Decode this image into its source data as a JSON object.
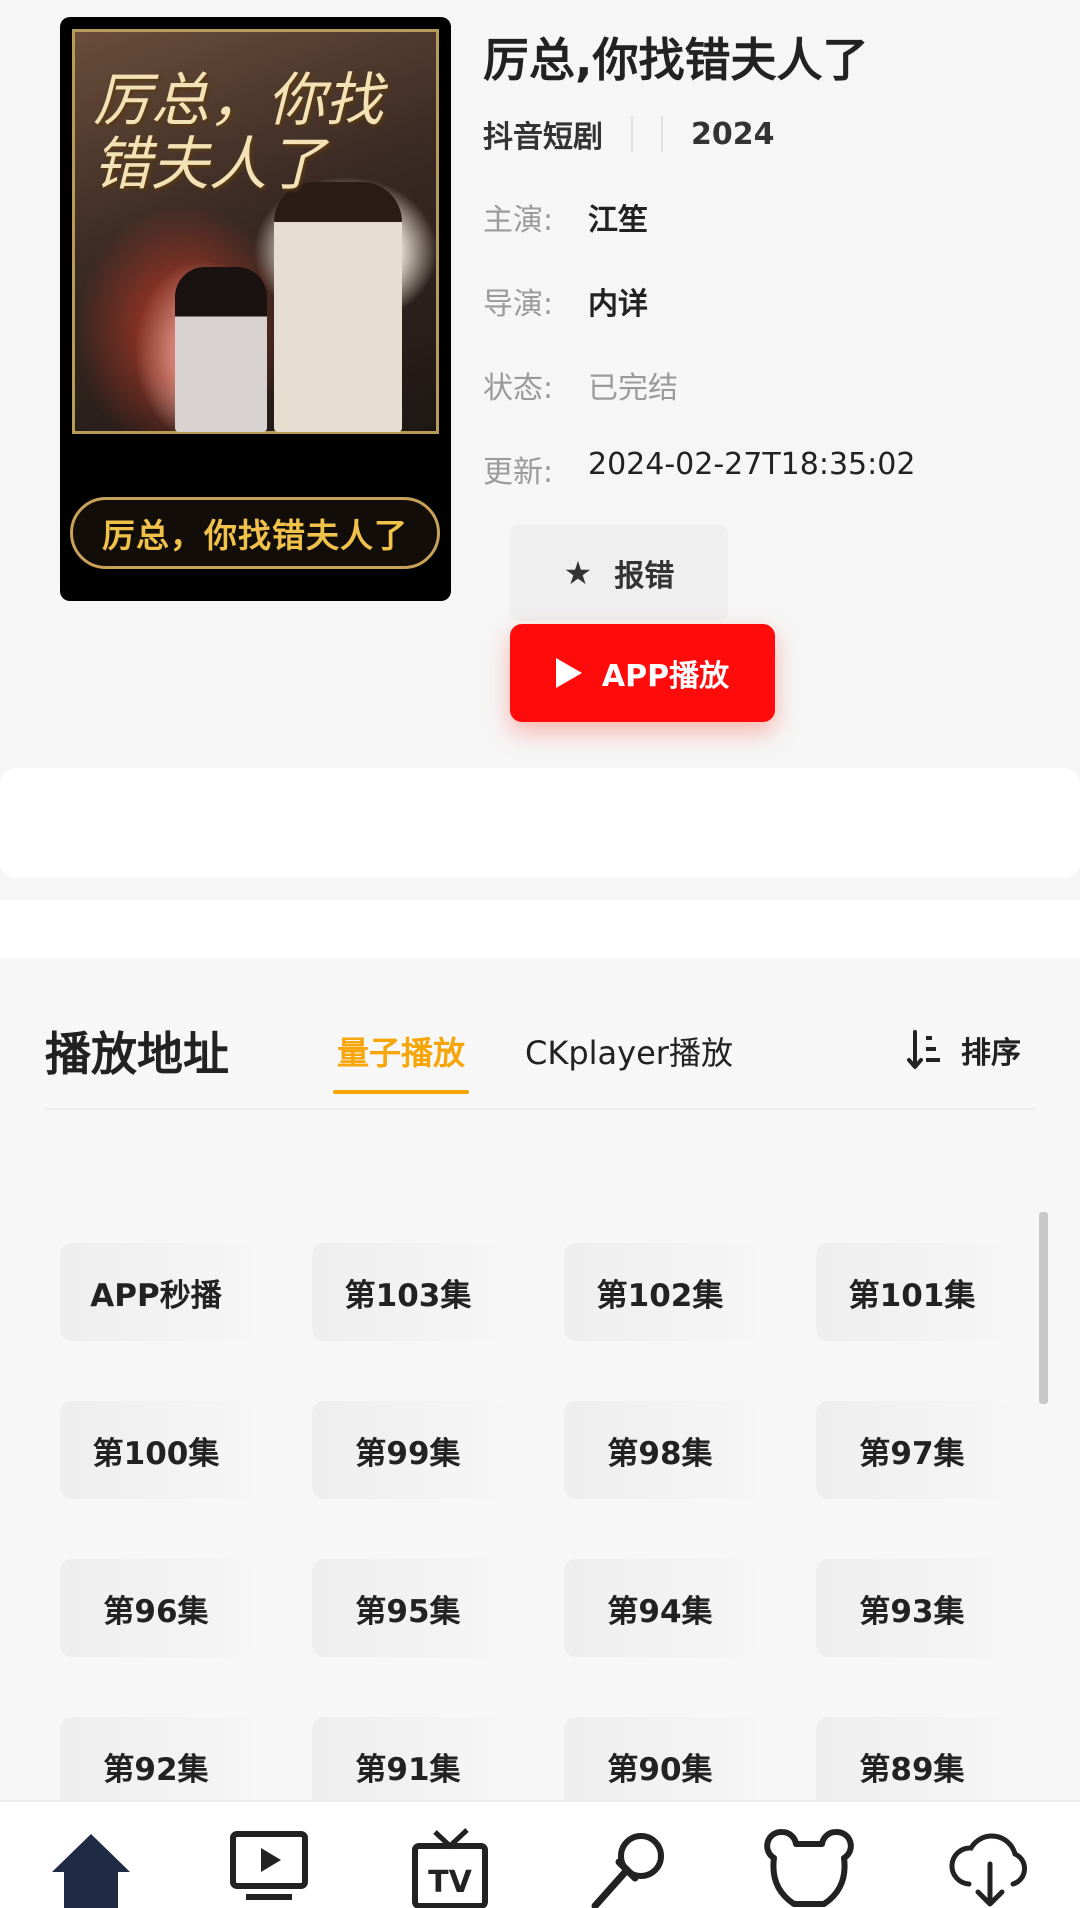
{
  "poster": {
    "art_title": "厉总，你找错夫人了",
    "pill_text": "厉总，你找错夫人了"
  },
  "detail": {
    "title": "厉总,你找错夫人了",
    "category": "抖音短剧",
    "year": "2024",
    "rows": [
      {
        "key": "主演:",
        "value": "江笙"
      },
      {
        "key": "导演:",
        "value": "内详"
      },
      {
        "key": "状态:",
        "value": "已完结"
      },
      {
        "key": "更新:",
        "value": "2024-02-27T18:35:02"
      }
    ]
  },
  "actions": {
    "report_label": "报错",
    "play_app_label": "APP播放"
  },
  "playlist": {
    "title": "播放地址",
    "tabs": [
      "量子播放",
      "CKplayer播放"
    ],
    "active_tab": 0,
    "sort_label": "排序",
    "episodes": [
      "APP秒播",
      "第103集",
      "第102集",
      "第101集",
      "第100集",
      "第99集",
      "第98集",
      "第97集",
      "第96集",
      "第95集",
      "第94集",
      "第93集",
      "第92集",
      "第91集",
      "第90集",
      "第89集"
    ]
  },
  "bottom_nav": [
    {
      "icon": "home-icon"
    },
    {
      "icon": "video-screen-icon"
    },
    {
      "icon": "tv-icon"
    },
    {
      "icon": "microphone-icon"
    },
    {
      "icon": "bear-icon"
    },
    {
      "icon": "cloud-download-icon"
    }
  ]
}
